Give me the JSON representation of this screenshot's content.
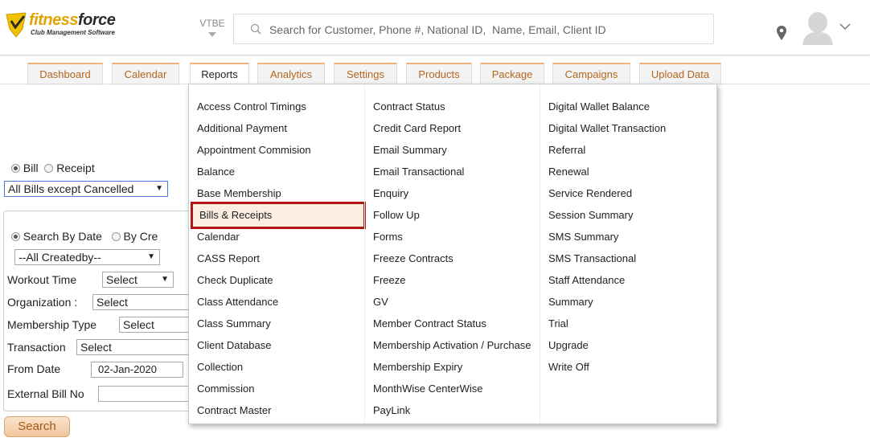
{
  "header": {
    "logo_name_part1": "fitness",
    "logo_name_part2": "force",
    "logo_tagline": "Club Management Software",
    "center_code": "VTBE",
    "search_placeholder": "Search for Customer, Phone #, National ID,  Name, Email, Client ID"
  },
  "tabs": [
    {
      "label": "Dashboard"
    },
    {
      "label": "Calendar"
    },
    {
      "label": "Reports"
    },
    {
      "label": "Analytics"
    },
    {
      "label": "Settings"
    },
    {
      "label": "Products"
    },
    {
      "label": "Package"
    },
    {
      "label": "Campaigns"
    },
    {
      "label": "Upload Data"
    }
  ],
  "active_tab": "Reports",
  "form": {
    "bill_label": "Bill",
    "receipt_label": "Receipt",
    "bill_type_selected": "All Bills except Cancelled",
    "search_by_date_label": "Search By Date",
    "by_created_label": "By Cre",
    "createdby_selected": "--All Createdby--",
    "workout_time_label": "Workout Time",
    "workout_time_selected": "Select",
    "organization_label": "Organization :",
    "organization_selected": "Select",
    "membership_type_label": "Membership Type",
    "membership_type_selected": "Select",
    "transaction_label": "Transaction",
    "transaction_selected": "Select",
    "from_date_label": "From Date",
    "from_date_value": "02-Jan-2020",
    "external_bill_label": "External Bill No",
    "external_bill_value": "",
    "search_button": "Search"
  },
  "reports_menu": {
    "columns": [
      [
        "Access Control Timings",
        "Additional Payment",
        "Appointment Commision",
        "Balance",
        "Base Membership",
        "Bills & Receipts",
        "Calendar",
        "CASS Report",
        "Check Duplicate",
        "Class Attendance",
        "Class Summary",
        "Client Database",
        "Collection",
        "Commission",
        "Contract Master"
      ],
      [
        "Contract Status",
        "Credit Card Report",
        "Email Summary",
        "Email Transactional",
        "Enquiry",
        "Follow Up",
        "Forms",
        "Freeze Contracts",
        "Freeze",
        "GV",
        "Member Contract Status",
        "Membership Activation / Purchase",
        "Membership Expiry",
        "MonthWise CenterWise",
        "PayLink"
      ],
      [
        "Digital Wallet Balance",
        "Digital Wallet Transaction",
        "Referral",
        "Renewal",
        "Service Rendered",
        "Session Summary",
        "SMS Summary",
        "SMS Transactional",
        "Staff Attendance",
        "Summary",
        "Trial",
        "Upgrade",
        "Write Off"
      ]
    ],
    "highlighted_item": "Bills & Receipts"
  },
  "colors": {
    "brand_yellow": "#e0a400",
    "tab_text": "#b4661c",
    "highlight_border": "#b01818",
    "highlight_bg": "#fbeee0"
  }
}
